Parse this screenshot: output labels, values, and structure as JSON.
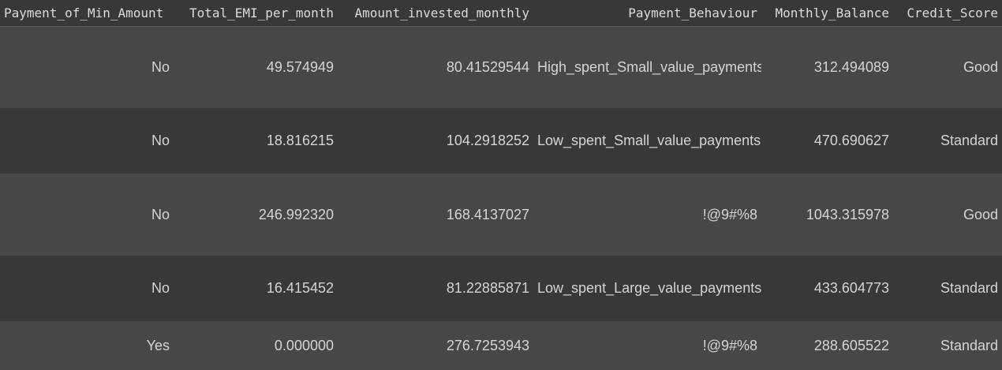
{
  "table": {
    "headers": [
      "Payment_of_Min_Amount",
      "Total_EMI_per_month",
      "Amount_invested_monthly",
      "Payment_Behaviour",
      "Monthly_Balance",
      "Credit_Score"
    ],
    "rows": [
      [
        "No",
        "49.574949",
        "80.41529544",
        "High_spent_Small_value_payments",
        "312.494089",
        "Good"
      ],
      [
        "No",
        "18.816215",
        "104.2918252",
        "Low_spent_Small_value_payments",
        "470.690627",
        "Standard"
      ],
      [
        "No",
        "246.992320",
        "168.4137027",
        "!@9#%8",
        "1043.315978",
        "Good"
      ],
      [
        "No",
        "16.415452",
        "81.22885871",
        "Low_spent_Large_value_payments",
        "433.604773",
        "Standard"
      ],
      [
        "Yes",
        "0.000000",
        "276.7253943",
        "!@9#%8",
        "288.605522",
        "Standard"
      ]
    ]
  },
  "colors": {
    "background_dark": "#383838",
    "background_light": "#474747",
    "text": "#d5d5d5"
  }
}
